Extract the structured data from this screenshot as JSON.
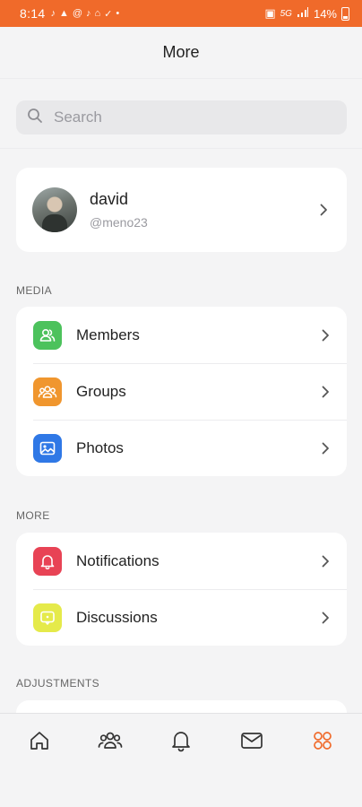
{
  "status_bar": {
    "time": "8:14",
    "notification_icons": [
      "tiktok-icon",
      "warning-icon",
      "at-icon",
      "tiktok-icon",
      "home-icon",
      "check-icon",
      "dot-icon"
    ],
    "network": "5G",
    "battery": "14%",
    "background_color": "#f06a2a"
  },
  "header": {
    "title": "More"
  },
  "search": {
    "placeholder": "Search"
  },
  "profile": {
    "name": "david",
    "handle": "@meno23"
  },
  "sections": {
    "media": {
      "label": "MEDIA",
      "items": [
        {
          "label": "Members",
          "icon": "members-icon",
          "color": "#4cc25c"
        },
        {
          "label": "Groups",
          "icon": "groups-icon",
          "color": "#f0962e"
        },
        {
          "label": "Photos",
          "icon": "photos-icon",
          "color": "#2f78e6"
        }
      ]
    },
    "more": {
      "label": "MORE",
      "items": [
        {
          "label": "Notifications",
          "icon": "bell-icon",
          "color": "#e84355"
        },
        {
          "label": "Discussions",
          "icon": "discussions-icon",
          "color": "#e5ea4a"
        }
      ]
    },
    "adjustments": {
      "label": "ADJUSTMENTS"
    }
  },
  "tabbar": {
    "items": [
      "home-icon",
      "community-icon",
      "notifications-icon",
      "messages-icon",
      "more-icon"
    ],
    "active": "more-icon",
    "active_color": "#f06a2a",
    "inactive_color": "#333333"
  }
}
